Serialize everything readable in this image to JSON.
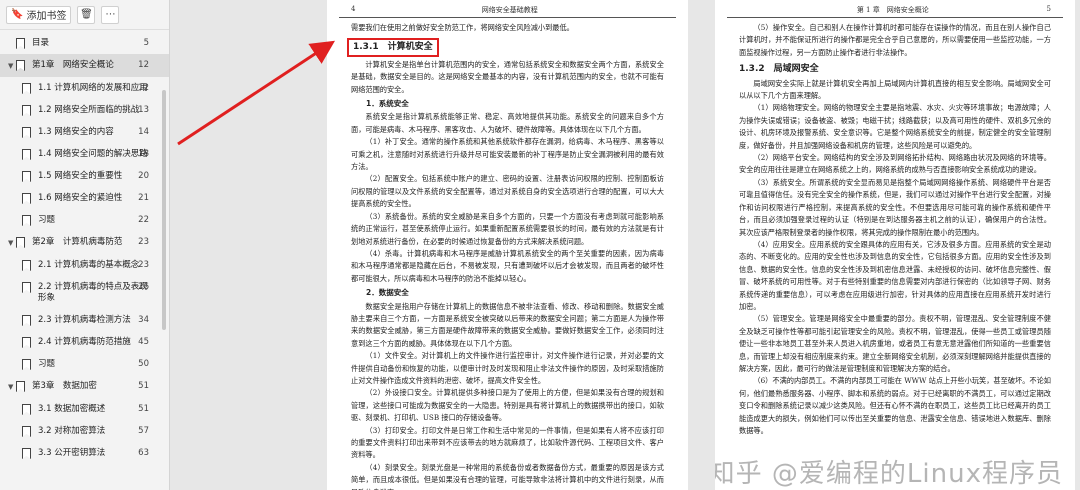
{
  "sidebar": {
    "add_bookmark": "添加书签",
    "items": [
      {
        "label": "目录",
        "page": "5",
        "level": 0,
        "caret": ""
      },
      {
        "label": "第1章　网络安全概论",
        "page": "12",
        "level": 0,
        "caret": "▼",
        "selected": true
      },
      {
        "label": "1.1 计算机网络的发展和应用",
        "page": "12",
        "level": 1
      },
      {
        "label": "1.2 网络安全所面临的挑战",
        "page": "13",
        "level": 1
      },
      {
        "label": "1.3 网络安全的内容",
        "page": "14",
        "level": 1
      },
      {
        "label": "1.4 网络安全问题的解决思路",
        "page": "18",
        "level": 1
      },
      {
        "label": "1.5 网络安全的重要性",
        "page": "20",
        "level": 1
      },
      {
        "label": "1.6 网络安全的紧迫性",
        "page": "21",
        "level": 1
      },
      {
        "label": "习题",
        "page": "22",
        "level": 1
      },
      {
        "label": "第2章　计算机病毒防范",
        "page": "23",
        "level": 0,
        "caret": "▼"
      },
      {
        "label": "2.1 计算机病毒的基本概念",
        "page": "23",
        "level": 1
      },
      {
        "label": "2.2 计算机病毒的特点及表现形象",
        "page": "26",
        "level": 1
      },
      {
        "label": "2.3 计算机病毒检测方法",
        "page": "34",
        "level": 1
      },
      {
        "label": "2.4 计算机病毒防范措施",
        "page": "45",
        "level": 1
      },
      {
        "label": "习题",
        "page": "50",
        "level": 1
      },
      {
        "label": "第3章　数据加密",
        "page": "51",
        "level": 0,
        "caret": "▼"
      },
      {
        "label": "3.1 数据加密概述",
        "page": "51",
        "level": 1
      },
      {
        "label": "3.2 对称加密算法",
        "page": "57",
        "level": 1
      },
      {
        "label": "3.3 公开密钥算法",
        "page": "63",
        "level": 1
      }
    ]
  },
  "left_page": {
    "page_number": "4",
    "running_title": "网络安全基础教程",
    "intro": "需要我们在使用之前做好安全防范工作，将网络安全风险减小到最低。",
    "section_title": "1.3.1　计算机安全",
    "p1": "计算机安全是指单台计算机范围内的安全，通常包括系统安全和数据安全两个方面，系统安全是基础，数据安全是目的。这是网络安全最基本的内容，没有计算机范围内的安全，也就不可能有网络范围的安全。",
    "sub1": "1．系统安全",
    "p2": "系统安全是指计算机系统能够正常、稳定、高效地提供其功能。系统安全的问题来自多个方面，可能是病毒、木马程序、黑客攻击、人为破坏、硬件故障等。具体体现在以下几个方面。",
    "p3": "（1）补丁安全。通常的操作系统和其他系统软件都存在漏洞，给病毒、木马程序、黑客等以可乘之机，注意随时对系统进行升级并尽可能安装最新的补丁程序是防止安全漏洞被利用的最有效方法。",
    "p4": "（2）配置安全。包括系统中账户的建立、密码的设置、注册表访问权限的控制、控制面板访问权限的管理以及文件系统的安全配置等，通过对系统自身的安全选项进行合理的配置，可以大大提高系统的安全性。",
    "p5": "（3）系统备份。系统的安全威胁是来自多个方面的，只要一个方面没有考虑到就可能影响系统的正常运行，甚至使系统停止运行。如果重新配置系统需要很长的时间，最有效的方法就是有计划地对系统进行备份，在必要的时候通过恢复备份的方式来解决系统问题。",
    "p6": "（4）杀毒。计算机病毒和木马程序是威胁计算机系统安全的两个至关重要的因素，因为病毒和木马程序通常都是隐藏在后台，不易被发现，只有遭到破坏以后才会被发现，而且两者的破坏性都可能很大，所以病毒和木马程序的防治不能掉以轻心。",
    "sub2": "2．数据安全",
    "p7": "数据安全是指用户存储在计算机上的数据信息不被非法查看、修改、移动和删除。数据安全威胁主要来自三个方面，一方面是系统安全被突破以后带来的数据安全问题；第二方面是人为操作带来的数据安全威胁，第三方面是硬件故障带来的数据安全威胁。要做好数据安全工作，必须同时注意到这三个方面的威胁。具体体现在以下几个方面。",
    "p8": "（1）文件安全。对计算机上的文件操作进行监控审计，对文件操作进行记录，并对必要的文件提供自动备份和恢复的功能，以便审计时及时发现和阻止非法文件操作的原因，及时采取措施防止对文件操作造成文件资料的泄密、破坏，提高文件安全性。",
    "p9": "（2）外设接口安全。计算机提供多种接口是为了使用上的方便，但是如果没有合理的规划和管理，这些接口可能成为数据安全的一大隐患。特别是具有将计算机上的数据携带出的接口，如软驱、刻录机、打印机、USB 接口的存储设备等。",
    "p10": "（3）打印安全。打印文件是日常工作和生活中常见的一件事情，但是如果有人将不应该打印的重要文件资料打印出来带到不应该带去的地方就麻烦了，比如软件源代码、工程项目文件、客户资料等。",
    "p11": "（4）刻录安全。刻录光盘是一种常用的系统备份或者数据备份方式，最重要的原因是该方式简单，而且成本很低。但是如果没有合理的管理，可能导致非法将计算机中的文件进行刻录，从而导致信息泄密。"
  },
  "right_page": {
    "running_title": "第 1 章　网络安全概论",
    "page_number": "5",
    "p1": "（5）操作安全。自己和别人在操作计算机时都可能存在误操作的情况，而且在别人操作自己计算机时，并不能保证所进行的操作都是完全合乎自己意愿的，所以需要使用一些监控功能，一方面监视操作过程，另一方面防止操作者进行非法操作。",
    "section_title": "1.3.2　局域网安全",
    "p2": "局域网安全实际上就是计算机安全再加上局域网内计算机直接的相互安全影响。局域网安全可以从以下几个方面来理解。",
    "p3": "（1）网络物理安全。网络的物理安全主要是指地震、水灾、火灾等环境事故；电源故障；人为操作失误或错误；设备被盗、被毁；电磁干扰；线路截获；以及高可用性的硬件、双机多冗余的设计、机房环境及报警系统、安全意识等。它是整个网络系统安全的前提，制定健全的安全管理制度，做好备份，并且加强网络设备和机房的管理，这些风险是可以避免的。",
    "p4": "（2）网络平台安全。网络结构的安全涉及到网络拓扑结构、网络路由状况及网络的环境等。安全的应用往往是建立在网络系统之上的，网络系统的成熟与否直接影响安全系统成功的建设。",
    "p5": "（3）系统安全。所谓系统的安全显而易见是指整个局域网网络操作系统、网络硬件平台是否可靠且值得信任。没有完全安全的操作系统，但是，我们可以通过对操作平台进行安全配置，对操作和访问权限进行严格控制，来提高系统的安全性。不但要选用尽可能可靠的操作系统和硬件平台，而且必须加强登录过程的认证（特别是在到达服务器主机之前的认证），确保用户的合法性。其次应该严格限制登录者的操作权限，将其完成的操作限制在最小的范围内。",
    "p6": "（4）应用安全。应用系统的安全跟具体的应用有关，它涉及很多方面。应用系统的安全是动态的、不断变化的。应用的安全性也涉及到信息的安全性，它包括很多方面。应用的安全性涉及到信息、数据的安全性。信息的安全性涉及到机密信息泄露、未经授权的访问、破坏信息完整性、假冒、破坏系统的可用性等。对于有些特别重要的信息需要对内部进行保密的（比如领导子网、财务系统传递的重要信息），可以考虑在应用级进行加密，针对具体的应用直接在应用系统开发时进行加密。",
    "p7": "（5）管理安全。管理是网络安全中最重要的部分。责权不明，管理混乱、安全管理制度不健全及缺乏可操作性等都可能引起管理安全的风险。责权不明，管理混乱，使得一些员工或管理员随便让一些非本地员工甚至外来人员进入机房重地，或者员工有意无意泄露他们所知道的一些重要信息，而管理上却没有相应制度来约束。建立全新网络安全机制，必须深刻理解网络并能提供直接的解决方案，因此，最可行的做法是管理制度和管理解决方案的结合。",
    "p8": "（6）不满的内部员工。不满的内部员工可能在 WWW 站点上开些小玩笑，甚至破坏。不论如何，他们最熟悉服务器、小程序、脚本和系统的弱点。对于已经离职的不满员工，可以通过定期改变口令和删除系统记录以减少这类风险。但还有心怀不满的在职员工，这些员工比已经离开的员工能造成更大的损失，例如他们可以传出至关重要的信息、泄露安全信息、错误地进入数据库、删除数据等。"
  },
  "watermark": "知乎 @爱编程的Linux程序员",
  "colors": {
    "annotation": "#e02020",
    "sidebar_bg": "#f3f3f3",
    "selected_bg": "#dcdcdc"
  }
}
